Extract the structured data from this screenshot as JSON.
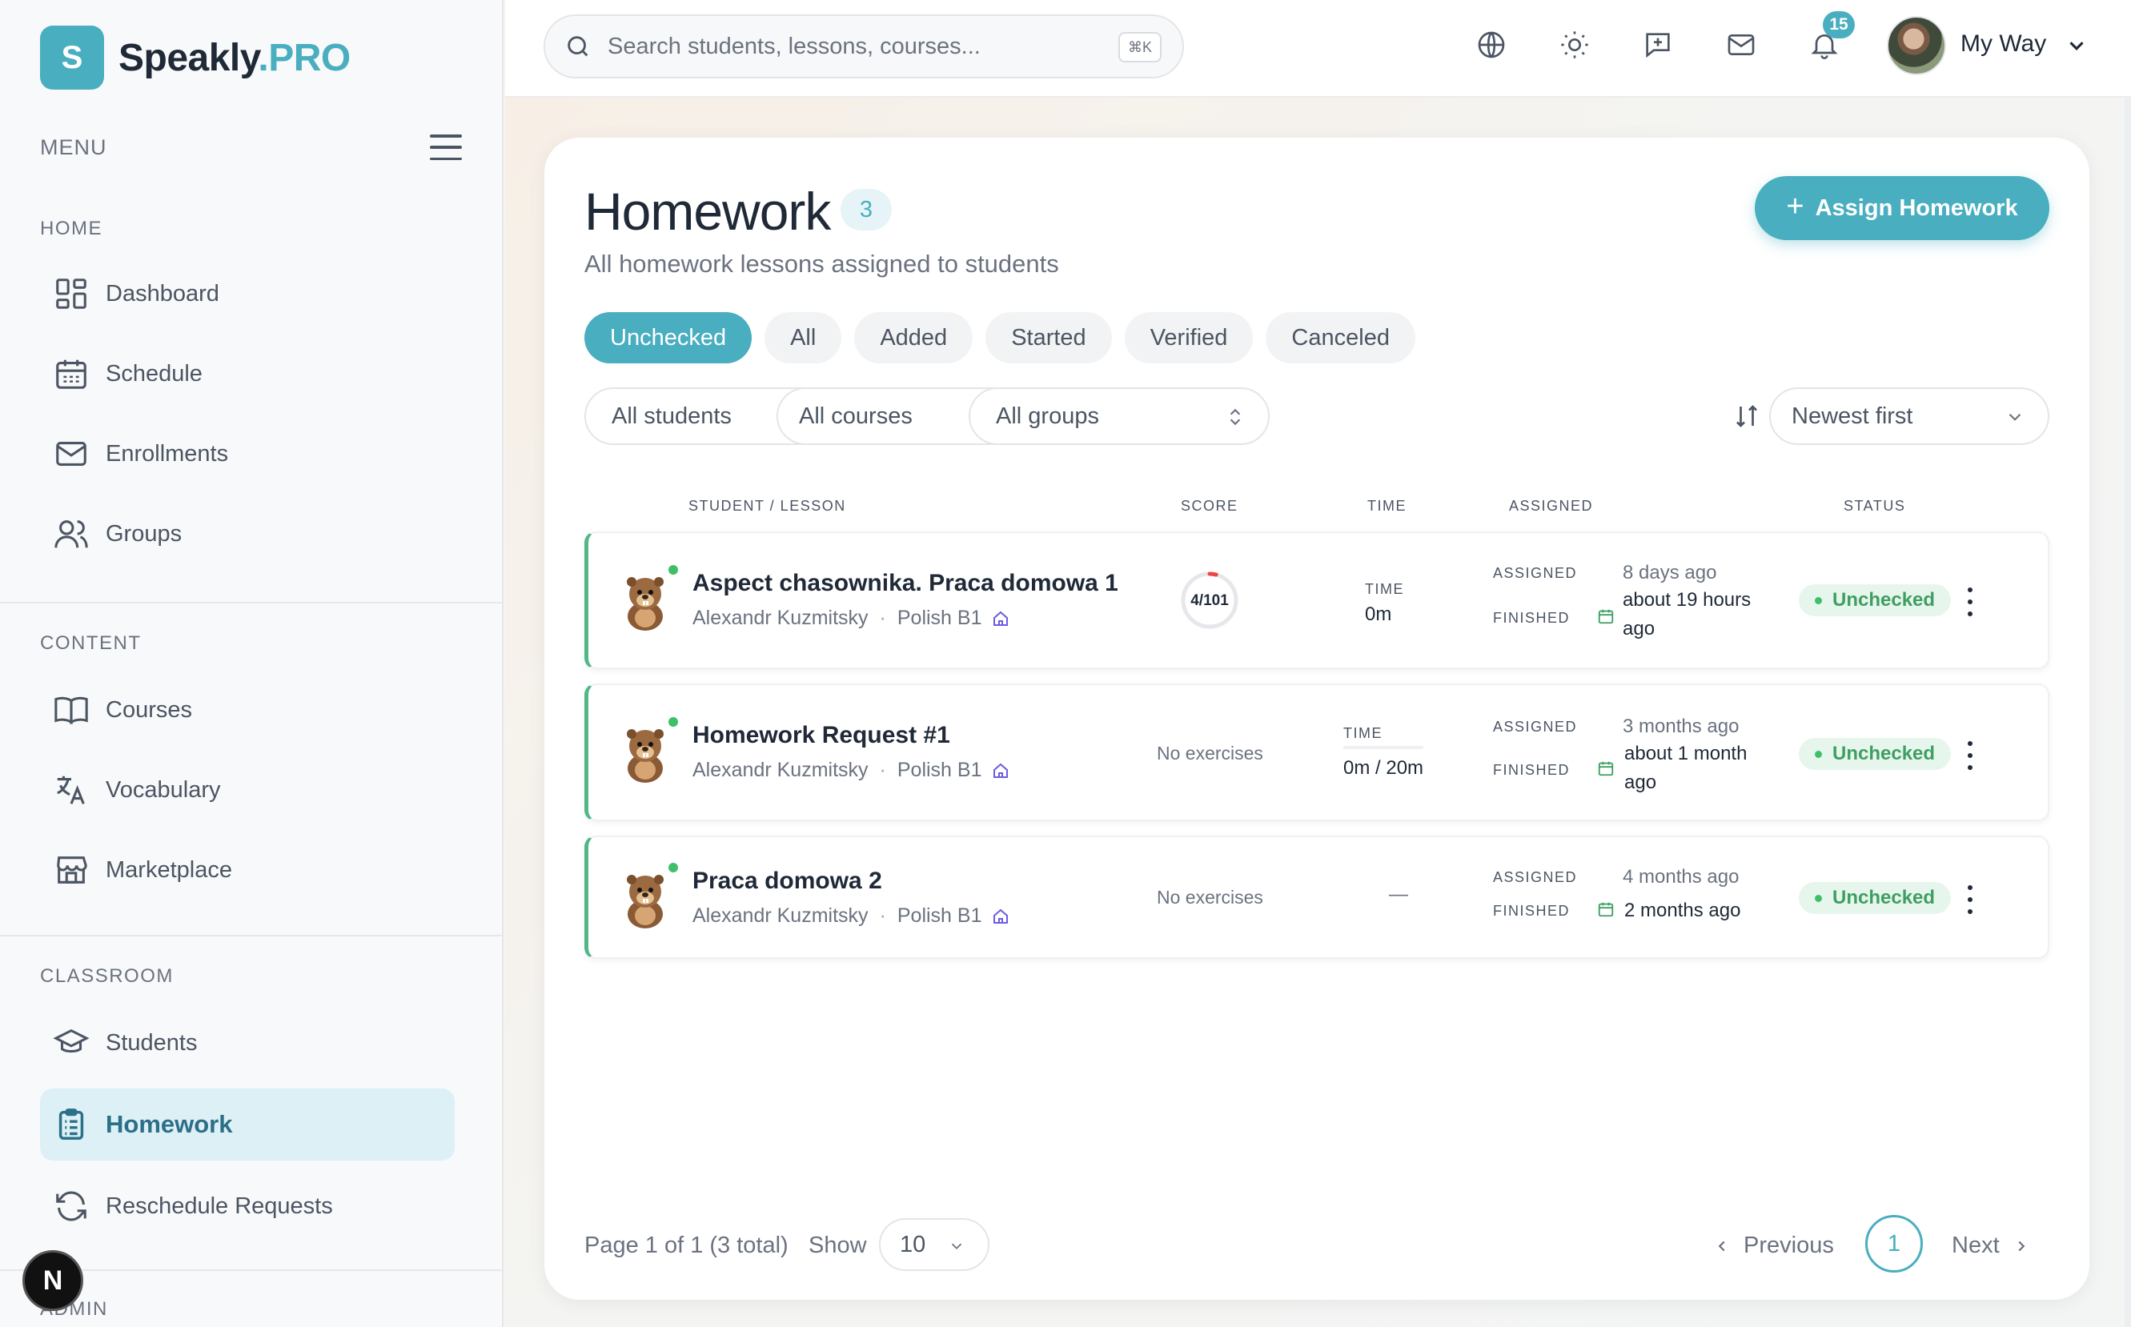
{
  "brand": {
    "letter": "S",
    "name": "Speakly",
    "suffix": ".PRO"
  },
  "sidebar": {
    "menu_label": "MENU",
    "sections": {
      "home": "HOME",
      "content": "CONTENT",
      "classroom": "CLASSROOM",
      "admin": "ADMIN"
    },
    "items": [
      {
        "label": "Dashboard",
        "icon": "dashboard-icon"
      },
      {
        "label": "Schedule",
        "icon": "calendar-icon"
      },
      {
        "label": "Enrollments",
        "icon": "mail-icon"
      },
      {
        "label": "Groups",
        "icon": "users-icon"
      },
      {
        "label": "Courses",
        "icon": "book-icon"
      },
      {
        "label": "Vocabulary",
        "icon": "translate-icon"
      },
      {
        "label": "Marketplace",
        "icon": "store-icon"
      },
      {
        "label": "Students",
        "icon": "graduation-cap-icon"
      },
      {
        "label": "Homework",
        "icon": "clipboard-icon",
        "active": true
      },
      {
        "label": "Reschedule Requests",
        "icon": "refresh-icon"
      }
    ],
    "floating_button": "N"
  },
  "topbar": {
    "search_placeholder": "Search students, lessons, courses...",
    "shortcut": "⌘K",
    "notifications_count": "15",
    "user_name": "My Way"
  },
  "page": {
    "title": "Homework",
    "count": "3",
    "subtitle": "All homework lessons assigned to students",
    "assign_button": "Assign Homework",
    "tabs": [
      "Unchecked",
      "All",
      "Added",
      "Started",
      "Verified",
      "Canceled"
    ],
    "active_tab": "Unchecked",
    "filters": {
      "students": "All students",
      "courses": "All courses",
      "groups": "All groups",
      "sort": "Newest first"
    },
    "columns": {
      "student_lesson": "STUDENT / LESSON",
      "score": "SCORE",
      "time": "TIME",
      "assigned": "ASSIGNED",
      "status": "STATUS"
    },
    "labels": {
      "time": "TIME",
      "assigned": "ASSIGNED",
      "finished": "FINISHED"
    },
    "rows": [
      {
        "title": "Aspect chasownika. Praca domowa 1",
        "student": "Alexandr Kuzmitsky",
        "course": "Polish B1",
        "score": "4/101",
        "score_fraction": 0.04,
        "time": "0m",
        "assigned": "8 days ago",
        "finished_line1": "about 19 hours",
        "finished_line2": "ago",
        "status": "Unchecked"
      },
      {
        "title": "Homework Request #1",
        "student": "Alexandr Kuzmitsky",
        "course": "Polish B1",
        "score": "No exercises",
        "time": "0m / 20m",
        "assigned": "3 months ago",
        "finished_line1": "about 1 month",
        "finished_line2": "ago",
        "status": "Unchecked"
      },
      {
        "title": "Praca domowa 2",
        "student": "Alexandr Kuzmitsky",
        "course": "Polish B1",
        "score": "No exercises",
        "time": "—",
        "assigned": "4 months ago",
        "finished_line1": "2 months ago",
        "status": "Unchecked"
      }
    ],
    "pagination": {
      "info": "Page 1 of 1 (3 total)",
      "show_label": "Show",
      "page_size": "10",
      "previous": "Previous",
      "current": "1",
      "next": "Next"
    }
  },
  "colors": {
    "accent": "#49aebf",
    "active_nav_bg": "#dcf0f6",
    "status_green": "#3f9e61",
    "row_border": "#52b788"
  }
}
